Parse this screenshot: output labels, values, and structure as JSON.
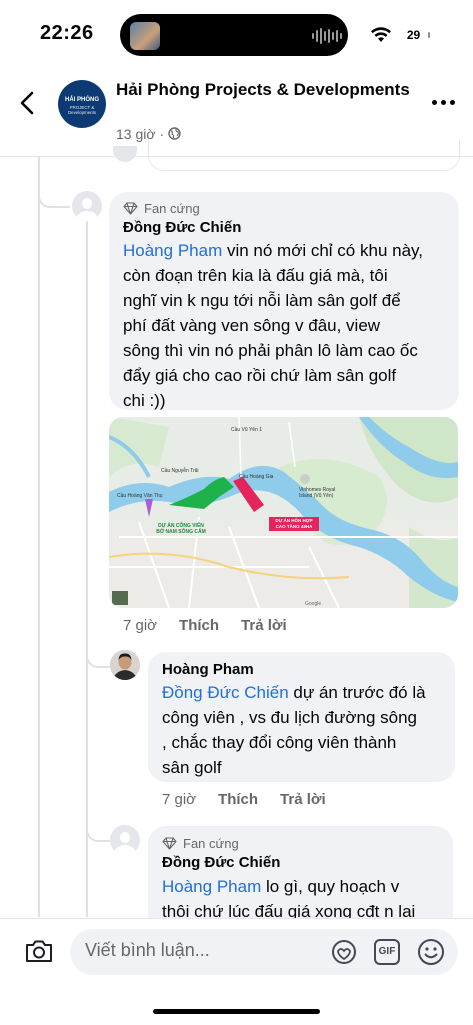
{
  "status_bar": {
    "time": "22:26",
    "battery": "29"
  },
  "header": {
    "page_name": "Hải Phòng Projects & Developments",
    "logo_text_main": "HẢI PHÒNG",
    "logo_text_sub": "PROJECT & Developments",
    "post_time": "13 giờ"
  },
  "comments": [
    {
      "badge": "Fan cứng",
      "author": "Đồng Đức Chiến",
      "mention": "Hoàng Pham",
      "lines": [
        " vin nó mới chỉ có khu này,",
        "còn đoạn trên kia là đấu giá mà, tôi",
        "nghĩ vin k ngu tới nỗi làm sân golf để",
        "phí đất vàng ven sông v đâu, view",
        "sông thì vin nó phải phân lô làm cao ốc",
        "đẩy giá cho cao rồi chứ làm sân golf",
        "chi :))"
      ],
      "time": "7 giờ",
      "like": "Thích",
      "reply": "Trả lời",
      "map": {
        "labels": {
          "bridge_vu_yen": "Cầu Vũ Yên 1",
          "bridge_nguyen_trai": "Cầu Nguyễn Trãi",
          "bridge_hoang_gia": "Cầu Hoàng Gia",
          "bridge_hoang_van_thu": "Cầu Hoàng Văn Thụ",
          "vinhomes": "Vinhomes Royal Island (Vũ Yên)",
          "park_project": "DỰ ÁN CÔNG VIÊN BỜ NAM SÔNG CẤM",
          "mixed_project": "DỰ ÁN HỖN HỢP CAO TẦNG 49HA",
          "google": "Google"
        }
      }
    },
    {
      "author": "Hoàng Pham",
      "mention": "Đồng Đức Chiến",
      "lines": [
        " dự án trước đó là",
        "công viên , vs đu lịch đường sông",
        ", chắc thay đổi công viên thành",
        "sân golf"
      ],
      "time": "7 giờ",
      "like": "Thích",
      "reply": "Trả lời"
    },
    {
      "badge": "Fan cứng",
      "author": "Đồng Đức Chiến",
      "mention": "Hoàng Pham",
      "lines": [
        " lo gì, quy hoạch v",
        "thôi chứ lúc đấu giá xong cđt n lại"
      ]
    }
  ],
  "composer": {
    "placeholder": "Viết bình luận...",
    "gif_label": "GIF"
  }
}
